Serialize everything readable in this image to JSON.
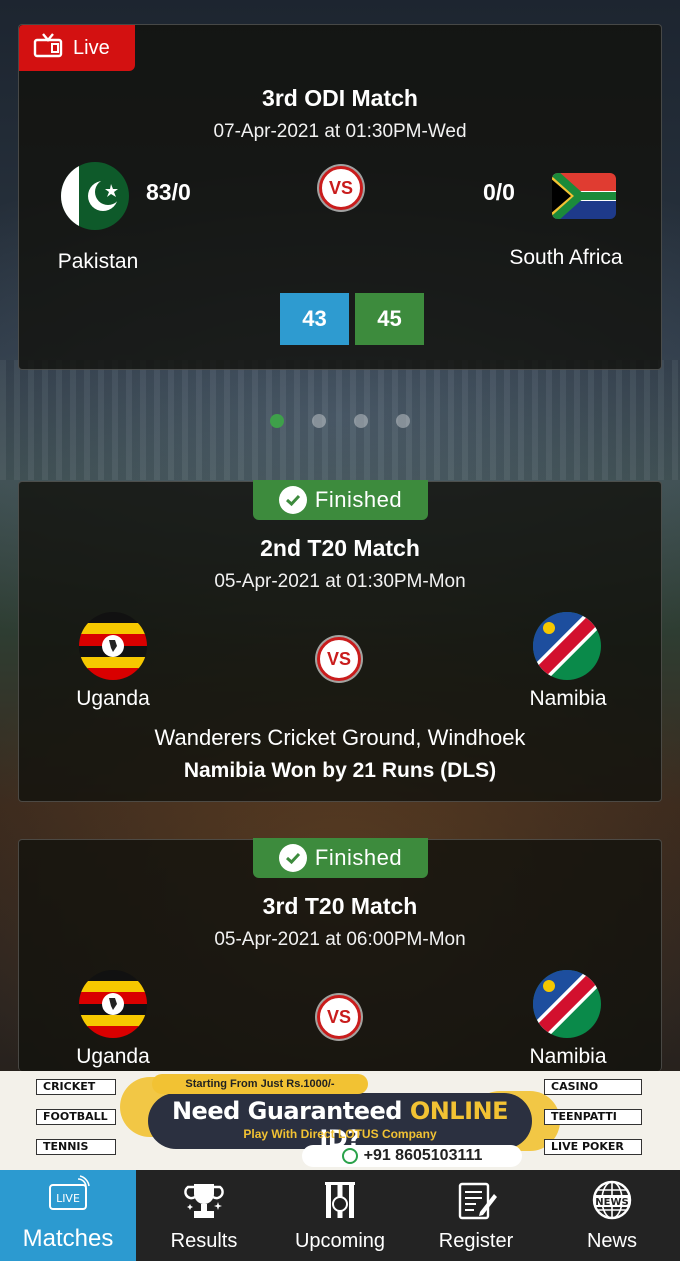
{
  "matches": [
    {
      "status": "Live",
      "title": "3rd ODI Match",
      "date": "07-Apr-2021 at 01:30PM-Wed",
      "team1": {
        "name": "Pakistan",
        "score": "83/0",
        "flag": "pakistan-flag"
      },
      "team2": {
        "name": "South Africa",
        "score": "0/0",
        "flag": "south-africa-flag"
      },
      "vs": "VS",
      "odds": [
        "43",
        "45"
      ]
    },
    {
      "status": "Finished",
      "title": "2nd T20 Match",
      "date": "05-Apr-2021 at 01:30PM-Mon",
      "team1": {
        "name": "Uganda",
        "flag": "uganda-flag"
      },
      "team2": {
        "name": "Namibia",
        "flag": "namibia-flag"
      },
      "vs": "VS",
      "venue": "Wanderers Cricket Ground, Windhoek",
      "result": "Namibia Won by 21 Runs (DLS)"
    },
    {
      "status": "Finished",
      "title": "3rd T20 Match",
      "date": "05-Apr-2021 at 06:00PM-Mon",
      "team1": {
        "name": "Uganda",
        "flag": "uganda-flag"
      },
      "team2": {
        "name": "Namibia",
        "flag": "namibia-flag"
      },
      "vs": "VS"
    }
  ],
  "carousel": {
    "count": 4,
    "active_index": 0
  },
  "ad": {
    "left_tags": [
      "CRICKET",
      "FOOTBALL",
      "TENNIS"
    ],
    "right_tags": [
      "CASINO",
      "TEENPATTI",
      "LIVE POKER"
    ],
    "top_text": "Starting From Just Rs.1000/-",
    "main_text_1": "Need Guaranteed ",
    "main_text_2": "ONLINE",
    "main_text_3": " ID?",
    "sub_text": "Play With Direct LOTUS Company",
    "phone": "+91 8605103111"
  },
  "nav": [
    {
      "label": "Matches",
      "icon": "live-tv-icon",
      "active": true
    },
    {
      "label": "Results",
      "icon": "trophy-icon",
      "active": false
    },
    {
      "label": "Upcoming",
      "icon": "cricket-stumps-icon",
      "active": false
    },
    {
      "label": "Register",
      "icon": "register-form-icon",
      "active": false
    },
    {
      "label": "News",
      "icon": "news-globe-icon",
      "active": false
    }
  ],
  "colors": {
    "live": "#d31111",
    "finished": "#3d8b3d",
    "odds_back": "#2e9bd0",
    "odds_lay": "#3d8b3d",
    "nav_active": "#2c9ad0",
    "nav_bg": "#232323"
  }
}
